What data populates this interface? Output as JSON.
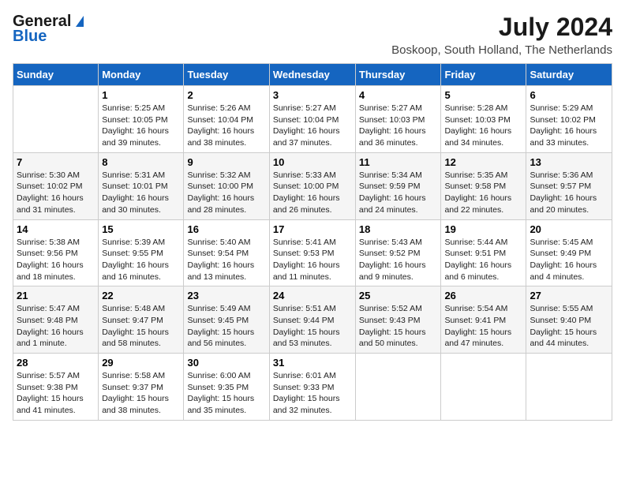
{
  "header": {
    "logo_general": "General",
    "logo_blue": "Blue",
    "month_year": "July 2024",
    "location": "Boskoop, South Holland, The Netherlands"
  },
  "days_of_week": [
    "Sunday",
    "Monday",
    "Tuesday",
    "Wednesday",
    "Thursday",
    "Friday",
    "Saturday"
  ],
  "weeks": [
    [
      {
        "day": "",
        "info": ""
      },
      {
        "day": "1",
        "info": "Sunrise: 5:25 AM\nSunset: 10:05 PM\nDaylight: 16 hours\nand 39 minutes."
      },
      {
        "day": "2",
        "info": "Sunrise: 5:26 AM\nSunset: 10:04 PM\nDaylight: 16 hours\nand 38 minutes."
      },
      {
        "day": "3",
        "info": "Sunrise: 5:27 AM\nSunset: 10:04 PM\nDaylight: 16 hours\nand 37 minutes."
      },
      {
        "day": "4",
        "info": "Sunrise: 5:27 AM\nSunset: 10:03 PM\nDaylight: 16 hours\nand 36 minutes."
      },
      {
        "day": "5",
        "info": "Sunrise: 5:28 AM\nSunset: 10:03 PM\nDaylight: 16 hours\nand 34 minutes."
      },
      {
        "day": "6",
        "info": "Sunrise: 5:29 AM\nSunset: 10:02 PM\nDaylight: 16 hours\nand 33 minutes."
      }
    ],
    [
      {
        "day": "7",
        "info": "Sunrise: 5:30 AM\nSunset: 10:02 PM\nDaylight: 16 hours\nand 31 minutes."
      },
      {
        "day": "8",
        "info": "Sunrise: 5:31 AM\nSunset: 10:01 PM\nDaylight: 16 hours\nand 30 minutes."
      },
      {
        "day": "9",
        "info": "Sunrise: 5:32 AM\nSunset: 10:00 PM\nDaylight: 16 hours\nand 28 minutes."
      },
      {
        "day": "10",
        "info": "Sunrise: 5:33 AM\nSunset: 10:00 PM\nDaylight: 16 hours\nand 26 minutes."
      },
      {
        "day": "11",
        "info": "Sunrise: 5:34 AM\nSunset: 9:59 PM\nDaylight: 16 hours\nand 24 minutes."
      },
      {
        "day": "12",
        "info": "Sunrise: 5:35 AM\nSunset: 9:58 PM\nDaylight: 16 hours\nand 22 minutes."
      },
      {
        "day": "13",
        "info": "Sunrise: 5:36 AM\nSunset: 9:57 PM\nDaylight: 16 hours\nand 20 minutes."
      }
    ],
    [
      {
        "day": "14",
        "info": "Sunrise: 5:38 AM\nSunset: 9:56 PM\nDaylight: 16 hours\nand 18 minutes."
      },
      {
        "day": "15",
        "info": "Sunrise: 5:39 AM\nSunset: 9:55 PM\nDaylight: 16 hours\nand 16 minutes."
      },
      {
        "day": "16",
        "info": "Sunrise: 5:40 AM\nSunset: 9:54 PM\nDaylight: 16 hours\nand 13 minutes."
      },
      {
        "day": "17",
        "info": "Sunrise: 5:41 AM\nSunset: 9:53 PM\nDaylight: 16 hours\nand 11 minutes."
      },
      {
        "day": "18",
        "info": "Sunrise: 5:43 AM\nSunset: 9:52 PM\nDaylight: 16 hours\nand 9 minutes."
      },
      {
        "day": "19",
        "info": "Sunrise: 5:44 AM\nSunset: 9:51 PM\nDaylight: 16 hours\nand 6 minutes."
      },
      {
        "day": "20",
        "info": "Sunrise: 5:45 AM\nSunset: 9:49 PM\nDaylight: 16 hours\nand 4 minutes."
      }
    ],
    [
      {
        "day": "21",
        "info": "Sunrise: 5:47 AM\nSunset: 9:48 PM\nDaylight: 16 hours\nand 1 minute."
      },
      {
        "day": "22",
        "info": "Sunrise: 5:48 AM\nSunset: 9:47 PM\nDaylight: 15 hours\nand 58 minutes."
      },
      {
        "day": "23",
        "info": "Sunrise: 5:49 AM\nSunset: 9:45 PM\nDaylight: 15 hours\nand 56 minutes."
      },
      {
        "day": "24",
        "info": "Sunrise: 5:51 AM\nSunset: 9:44 PM\nDaylight: 15 hours\nand 53 minutes."
      },
      {
        "day": "25",
        "info": "Sunrise: 5:52 AM\nSunset: 9:43 PM\nDaylight: 15 hours\nand 50 minutes."
      },
      {
        "day": "26",
        "info": "Sunrise: 5:54 AM\nSunset: 9:41 PM\nDaylight: 15 hours\nand 47 minutes."
      },
      {
        "day": "27",
        "info": "Sunrise: 5:55 AM\nSunset: 9:40 PM\nDaylight: 15 hours\nand 44 minutes."
      }
    ],
    [
      {
        "day": "28",
        "info": "Sunrise: 5:57 AM\nSunset: 9:38 PM\nDaylight: 15 hours\nand 41 minutes."
      },
      {
        "day": "29",
        "info": "Sunrise: 5:58 AM\nSunset: 9:37 PM\nDaylight: 15 hours\nand 38 minutes."
      },
      {
        "day": "30",
        "info": "Sunrise: 6:00 AM\nSunset: 9:35 PM\nDaylight: 15 hours\nand 35 minutes."
      },
      {
        "day": "31",
        "info": "Sunrise: 6:01 AM\nSunset: 9:33 PM\nDaylight: 15 hours\nand 32 minutes."
      },
      {
        "day": "",
        "info": ""
      },
      {
        "day": "",
        "info": ""
      },
      {
        "day": "",
        "info": ""
      }
    ]
  ]
}
